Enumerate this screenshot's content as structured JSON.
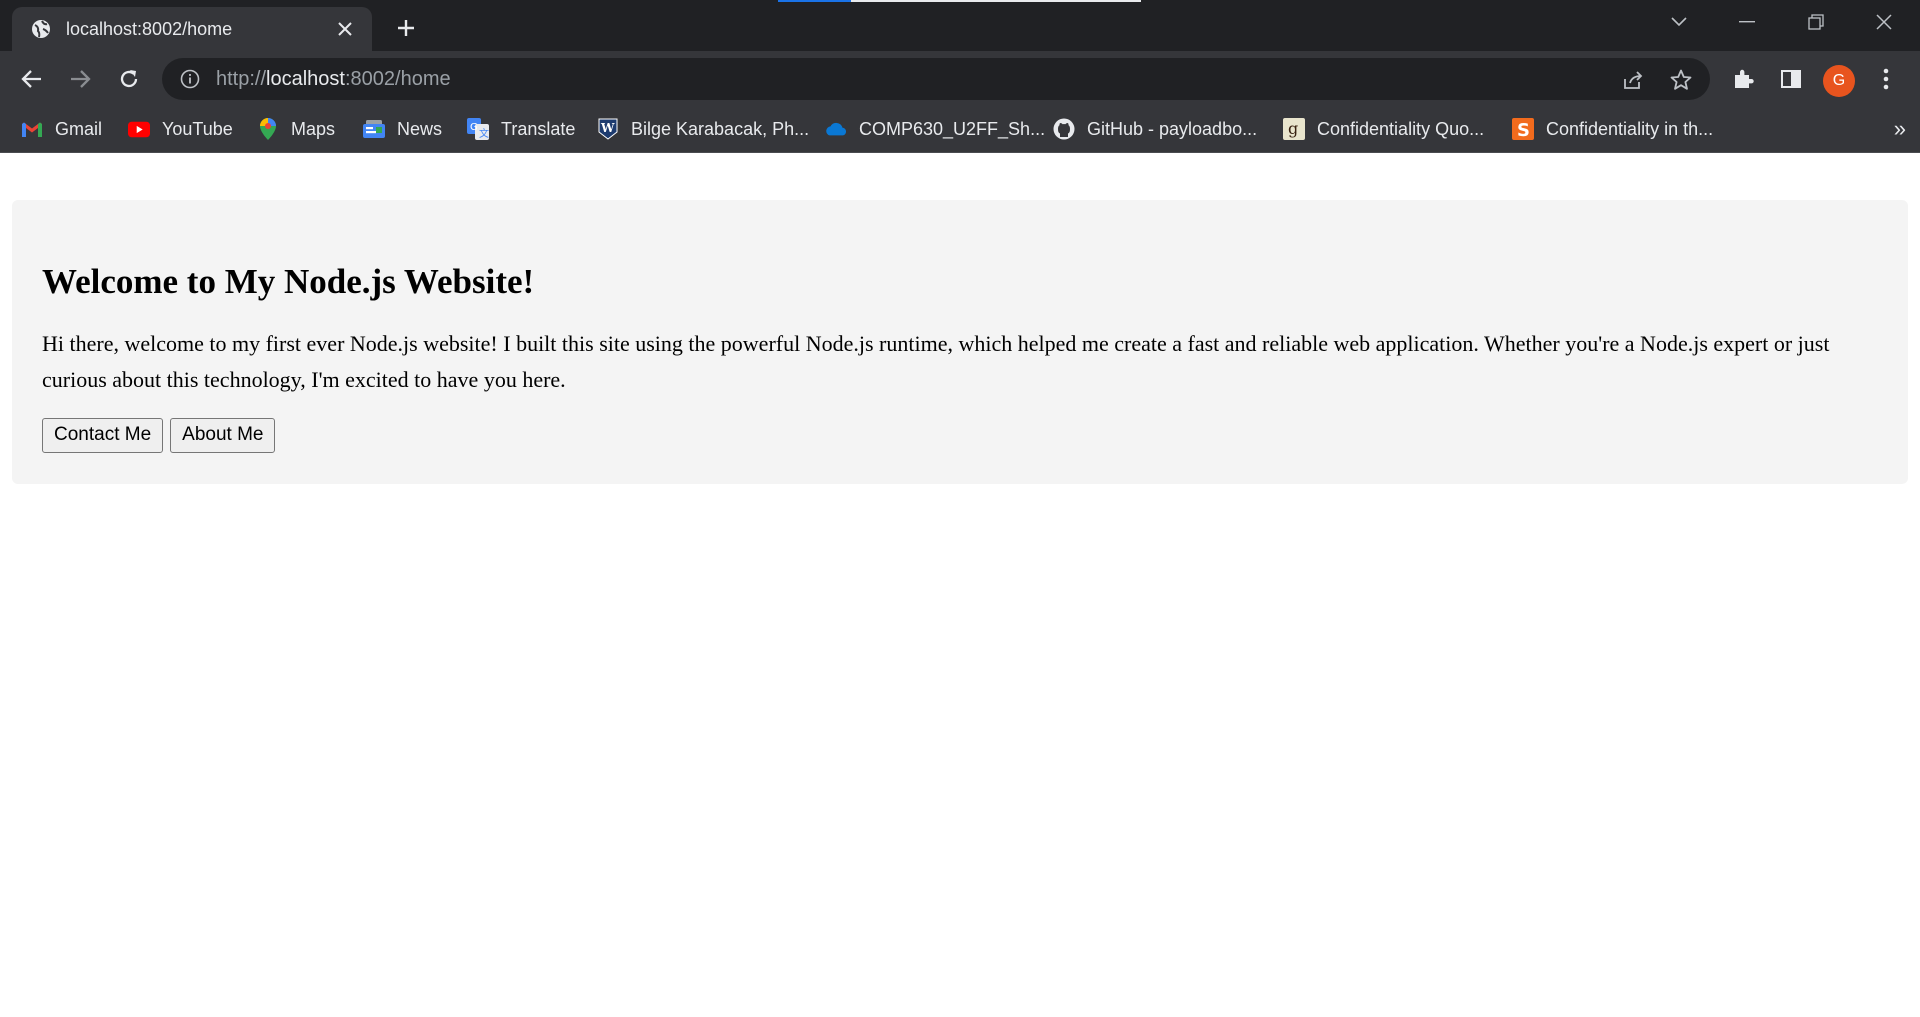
{
  "tab": {
    "title": "localhost:8002/home"
  },
  "address_bar": {
    "scheme": "http://",
    "host": "localhost",
    "rest": ":8002/home"
  },
  "profile": {
    "initial": "G",
    "color": "#e8541e"
  },
  "bookmarks": [
    {
      "label": "Gmail",
      "icon": "gmail-icon"
    },
    {
      "label": "YouTube",
      "icon": "youtube-icon"
    },
    {
      "label": "Maps",
      "icon": "maps-icon"
    },
    {
      "label": "News",
      "icon": "news-icon"
    },
    {
      "label": "Translate",
      "icon": "translate-icon"
    },
    {
      "label": "Bilge Karabacak, Ph...",
      "icon": "w-icon"
    },
    {
      "label": "COMP630_U2FF_Sh...",
      "icon": "onedrive-icon"
    },
    {
      "label": "GitHub - payloadbo...",
      "icon": "github-icon"
    },
    {
      "label": "Confidentiality Quo...",
      "icon": "goodreads-icon"
    },
    {
      "label": "Confidentiality in th...",
      "icon": "s-icon"
    }
  ],
  "bookmarks_more": "»",
  "page": {
    "heading": "Welcome to My Node.js Website!",
    "intro": "Hi there, welcome to my first ever Node.js website! I built this site using the powerful Node.js runtime, which helped me create a fast and reliable web application. Whether you're a Node.js expert or just curious about this technology, I'm excited to have you here.",
    "buttons": {
      "contact": "Contact Me",
      "about": "About Me"
    }
  }
}
